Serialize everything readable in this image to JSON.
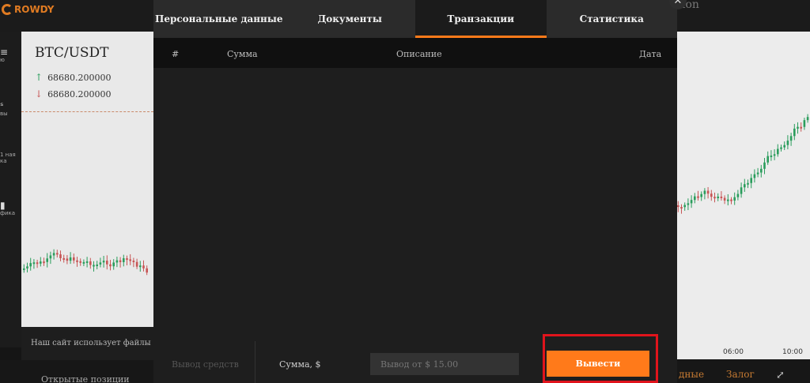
{
  "app": {
    "logo_text": "ROWDY",
    "top_right_text": "ion"
  },
  "left_nav": [
    {
      "label": "ю",
      "icon": "menu-icon"
    },
    {
      "label": "вы",
      "icon": "info-icon"
    },
    {
      "label": "1 ная ка",
      "icon": "number-icon"
    },
    {
      "label": "фика",
      "icon": "chart-icon"
    }
  ],
  "chart_panel": {
    "pair": "BTC/USDT",
    "price_up": "68680.200000",
    "price_down": "68680.200000"
  },
  "cookie_notice": "Наш сайт использует файлы cook",
  "open_positions": "Открытые позиции",
  "right_panel": {
    "time_labels": [
      "06:00",
      "10:00"
    ],
    "bottom_left": "дные",
    "bottom_right": "Залог"
  },
  "modal": {
    "tabs": [
      {
        "label": "Персональные данные",
        "active": false
      },
      {
        "label": "Документы",
        "active": false
      },
      {
        "label": "Транзакции",
        "active": true
      },
      {
        "label": "Статистика",
        "active": false
      }
    ],
    "table_headers": {
      "num": "#",
      "amount": "Сумма",
      "description": "Описание",
      "date": "Дата"
    },
    "rows": [],
    "withdraw_label": "Вывод средств",
    "amount_label": "Сумма, $",
    "amount_placeholder": "Вывод от $ 15.00",
    "withdraw_button": "Вывести",
    "close_icon": "close-icon"
  },
  "colors": {
    "accent": "#ff7a1a",
    "highlight": "#e0141c",
    "up": "#2a9d5c",
    "down": "#c75555"
  }
}
